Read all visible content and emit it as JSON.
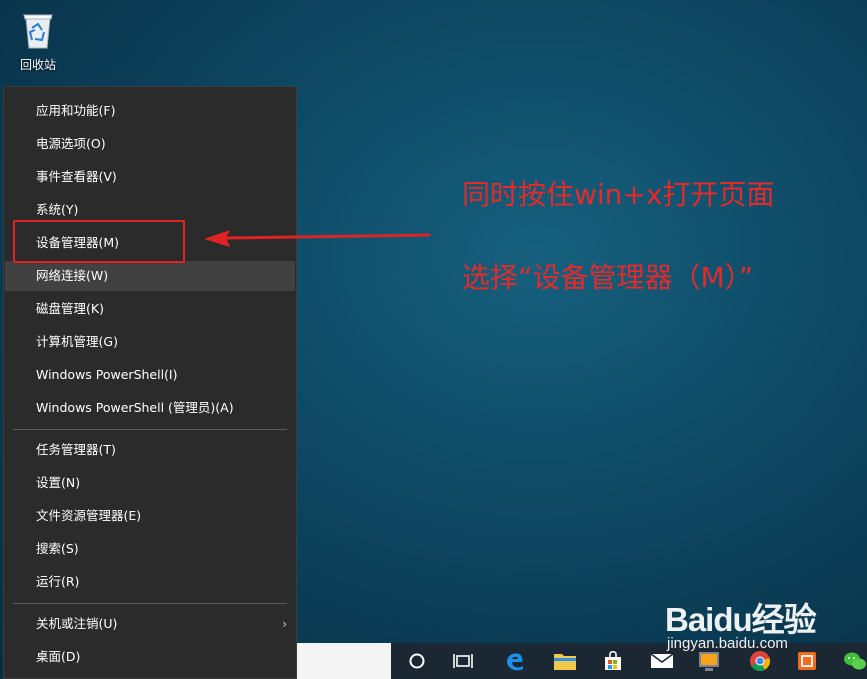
{
  "desktop": {
    "recycle_bin_label": "回收站"
  },
  "menu": {
    "items": [
      {
        "label": "应用和功能(F)"
      },
      {
        "label": "电源选项(O)"
      },
      {
        "label": "事件查看器(V)"
      },
      {
        "label": "系统(Y)"
      },
      {
        "label": "设备管理器(M)"
      },
      {
        "label": "网络连接(W)"
      },
      {
        "label": "磁盘管理(K)"
      },
      {
        "label": "计算机管理(G)"
      },
      {
        "label": "Windows PowerShell(I)"
      },
      {
        "label": "Windows PowerShell (管理员)(A)"
      },
      {
        "label": "任务管理器(T)"
      },
      {
        "label": "设置(N)"
      },
      {
        "label": "文件资源管理器(E)"
      },
      {
        "label": "搜索(S)"
      },
      {
        "label": "运行(R)"
      },
      {
        "label": "关机或注销(U)"
      },
      {
        "label": "桌面(D)"
      }
    ],
    "hovered_item": "网络连接(W)",
    "highlighted_item": "设备管理器(M)"
  },
  "annotation": {
    "line1": "同时按住win+x打开页面",
    "line2": "选择“设备管理器（M）”",
    "color": "#e62a2a"
  },
  "taskbar": {
    "icons": [
      "cortana-circle-icon",
      "task-view-icon",
      "edge-icon",
      "file-explorer-icon",
      "store-icon",
      "mail-icon",
      "vmware-icon",
      "chrome-icon",
      "office-icon",
      "wechat-icon"
    ]
  },
  "watermark": {
    "brand": "Baidu经验",
    "url": "jingyan.baidu.com"
  }
}
